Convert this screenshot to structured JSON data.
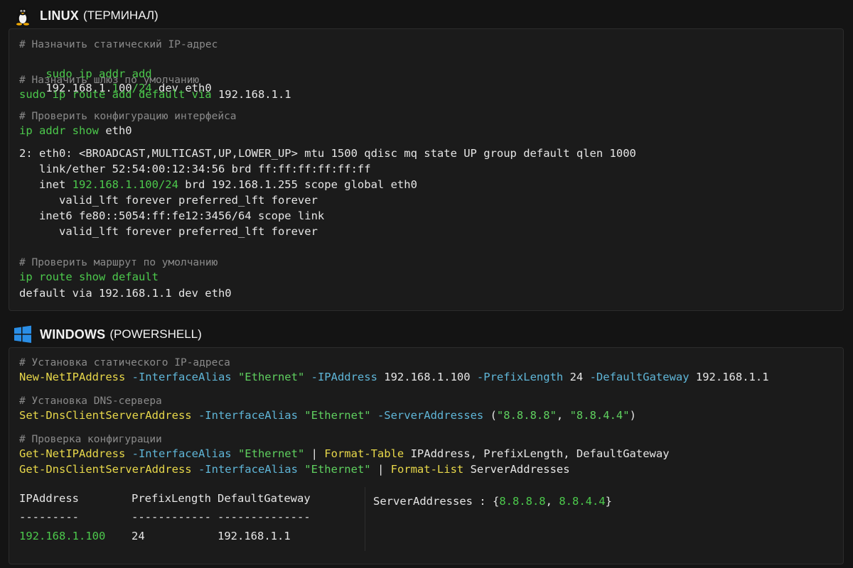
{
  "linux": {
    "title": "LINUX",
    "subtitle": "(ТЕРМИНАЛ)",
    "icon": "linux-tux-icon",
    "cmt1": "# Назначить статический IP-адрес",
    "c1_cmd": "sudo ip addr add",
    "c1_ip_a": "192.168.1.",
    "c1_ip_b": "1",
    "c1_ip_c": "00",
    "c1_mask": "/24",
    "c1_tail": " dev eth0",
    "cmt2": "# Назначить шлюз по умолчанию",
    "c2_cmd": "sudo ip route add default via",
    "c2_tail": " 192.168.1.1",
    "cmt3": "# Проверить конфигурацию интерфейса",
    "c3_cmd": "ip addr show",
    "c3_tail": " eth0",
    "out1": "2: eth0: <BROADCAST,MULTICAST,UP,LOWER_UP> mtu 1500 qdisc mq state UP group default qlen 1000",
    "out2": "   link/ether 52:54:00:12:34:56 brd ff:ff:ff:ff:ff:ff",
    "out3_pre": "   inet ",
    "out3_ip": "192.168.1.100/24",
    "out3_post": " brd 192.168.1.255 scope global eth0",
    "out4": "      valid_lft forever preferred_lft forever",
    "out5": "   inet6 fe80::5054:ff:fe12:3456/64 scope link",
    "out6": "      valid_lft forever preferred_lft forever",
    "cmt4": "# Проверить маршрут по умолчанию",
    "c4_cmd": "ip route show default",
    "out7": "default via 192.168.1.1 dev eth0"
  },
  "windows": {
    "title": "WINDOWS",
    "subtitle": "(POWERSHELL)",
    "icon": "windows-logo-icon",
    "cmt1": "# Установка статического IP-адреса",
    "p1_cmd": "New-NetIPAddress",
    "p1_a1": " -InterfaceAlias",
    "p1_v1": " \"Ethernet\"",
    "p1_a2": " -IPAddress",
    "p1_v2": " 192.168.1.100",
    "p1_a3": " -PrefixLength",
    "p1_v3": " 24",
    "p1_a4": " -DefaultGateway",
    "p1_v4": " 192.168.1.1",
    "cmt2": "# Установка DNS-сервера",
    "p2_cmd": "Set-DnsClientServerAddress",
    "p2_a1": " -InterfaceAlias",
    "p2_v1": " \"Ethernet\"",
    "p2_a2": " -ServerAddresses",
    "p2_open": " (",
    "p2_s1": "\"8.8.8.8\"",
    "p2_comma": ", ",
    "p2_s2": "\"8.8.4.4\"",
    "p2_close": ")",
    "cmt3": "# Проверка конфигурации",
    "p3_cmd": "Get-NetIPAddress",
    "p3_a1": " -InterfaceAlias",
    "p3_v1": " \"Ethernet\"",
    "p3_pipe": " | ",
    "p3_fmt": "Format-Table",
    "p3_tail": " IPAddress, PrefixLength, DefaultGateway",
    "p4_cmd": "Get-DnsClientServerAddress",
    "p4_a1": " -InterfaceAlias",
    "p4_v1": " \"Ethernet\"",
    "p4_pipe": " | ",
    "p4_fmt": "Format-List",
    "p4_tail": " ServerAddresses",
    "table": {
      "headers": [
        "IPAddress",
        "PrefixLength",
        "DefaultGateway"
      ],
      "dashes": [
        "---------",
        "------------",
        "--------------"
      ],
      "row": [
        "192.168.1.100",
        "24",
        "192.168.1.1"
      ]
    },
    "list_label": "ServerAddresses : {",
    "list_v1": "8.8.8.8",
    "list_sep": ", ",
    "list_v2": "8.8.4.4",
    "list_close": "}"
  },
  "colors": {
    "background": "#141414",
    "panel": "#1b1b1b",
    "comment": "#8a8a8a",
    "linux_cmd": "#4cc94c",
    "ps_cmdlet": "#e8d84a",
    "ps_param": "#5fb6d8",
    "ps_string": "#5fd05f"
  }
}
